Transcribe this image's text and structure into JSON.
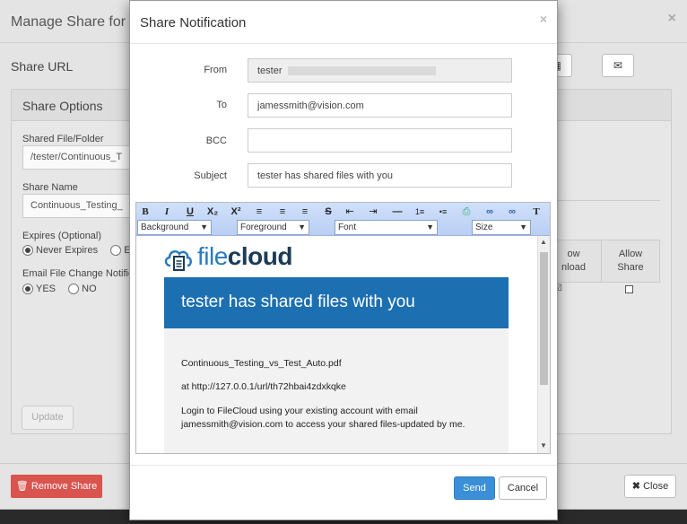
{
  "background": {
    "title": "Manage Share for fi",
    "share_url_label": "Share URL",
    "panel_title": "Share Options",
    "shared_file_label": "Shared File/Folder",
    "shared_file_value": "/tester/Continuous_T",
    "share_name_label": "Share Name",
    "share_name_value": "Continuous_Testing_",
    "expires_label": "Expires (Optional)",
    "never_expires": "Never Expires",
    "expires_other": "Ex",
    "email_change_label": "Email File Change Notific",
    "yes": "YES",
    "no": "NO",
    "perm_col1": "ow\nnload",
    "perm_col2": "Allow\nShare",
    "update_label": "Update",
    "remove_share_label": "Remove Share",
    "close_label": "Close"
  },
  "dialog": {
    "title": "Share Notification",
    "from_label": "From",
    "from_value": "tester",
    "to_label": "To",
    "to_value": "jamessmith@vision.com",
    "bcc_label": "BCC",
    "bcc_value": "",
    "subject_label": "Subject",
    "subject_value": "tester has shared files with you",
    "send_label": "Send",
    "cancel_label": "Cancel"
  },
  "toolbar": {
    "buttons": [
      "B",
      "I",
      "U",
      "X₂",
      "X²",
      "≡",
      "≡",
      "≡",
      "S",
      "⇤",
      "⇥",
      "—",
      "1≡",
      "•≡",
      "⎙",
      "∞",
      "∞",
      "T"
    ],
    "background_select": "Background",
    "foreground_select": "Foreground",
    "font_select": "Font",
    "size_select": "Size"
  },
  "email": {
    "logo_file": "file",
    "logo_cloud": "cloud",
    "banner": "tester has shared files with you",
    "filename": "Continuous_Testing_vs_Test_Auto.pdf",
    "link_line": "at http://127.0.0.1/url/th72hbai4zdxkqke",
    "login_line1": "Login to FileCloud using your existing account with email",
    "login_line2": "jamessmith@vision.com to access your shared files-updated by me."
  },
  "colors": {
    "banner": "#1c6fb0",
    "send": "#3a8fd8",
    "remove": "#d9534f"
  }
}
